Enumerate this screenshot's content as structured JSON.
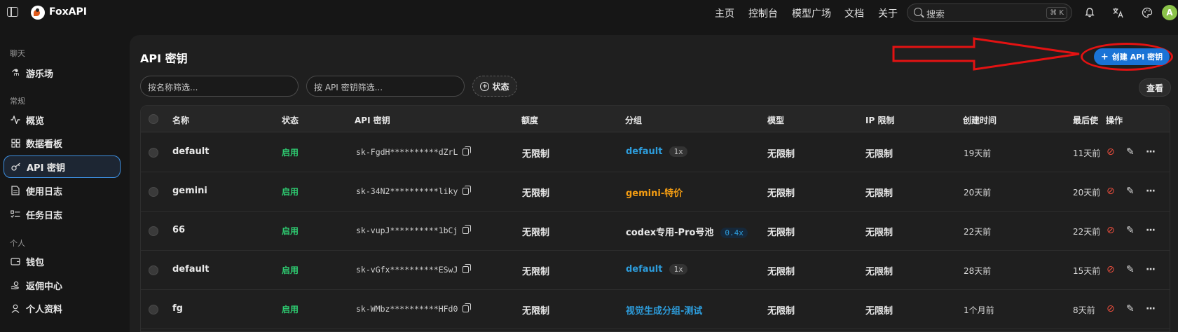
{
  "app": {
    "title": "FoxAPI"
  },
  "topnav": {
    "items": [
      "主页",
      "控制台",
      "模型广场",
      "文档",
      "关于"
    ]
  },
  "search": {
    "placeholder": "搜索",
    "shortcut": "⌘ K"
  },
  "icons": {
    "notifications": "bell-icon",
    "language": "translate-icon",
    "theme": "palette-icon"
  },
  "user": {
    "avatar_letter": "A"
  },
  "sidebar": {
    "sections": [
      {
        "label": "聊天",
        "items": [
          {
            "label": "游乐场",
            "icon": "flask-icon"
          }
        ]
      },
      {
        "label": "常规",
        "items": [
          {
            "label": "概览",
            "icon": "activity-icon"
          },
          {
            "label": "数据看板",
            "icon": "dashboard-icon"
          },
          {
            "label": "API 密钥",
            "icon": "key-icon",
            "active": true
          },
          {
            "label": "使用日志",
            "icon": "log-icon"
          },
          {
            "label": "任务日志",
            "icon": "task-list-icon"
          }
        ]
      },
      {
        "label": "个人",
        "items": [
          {
            "label": "钱包",
            "icon": "wallet-icon"
          },
          {
            "label": "返佣中心",
            "icon": "commission-icon"
          },
          {
            "label": "个人资料",
            "icon": "user-icon"
          }
        ]
      }
    ]
  },
  "page": {
    "title": "API 密钥",
    "create_button": "创建 API 密钥",
    "filter_name_placeholder": "按名称筛选...",
    "filter_key_placeholder": "按 API 密钥筛选...",
    "status_filter": "状态",
    "view_button": "查看"
  },
  "table": {
    "columns": [
      "名称",
      "状态",
      "API 密钥",
      "额度",
      "分组",
      "模型",
      "IP 限制",
      "创建时间",
      "最后使",
      "操作"
    ],
    "rows": [
      {
        "name": "default",
        "status": "启用",
        "key": "sk-FgdH**********dZrL",
        "quota": "无限制",
        "group": "default",
        "group_style": "blue",
        "ratio": "1x",
        "model": "无限制",
        "ip": "无限制",
        "created": "19天前",
        "last_used": "11天前"
      },
      {
        "name": "gemini",
        "status": "启用",
        "key": "sk-34N2**********liky",
        "quota": "无限制",
        "group": "gemini-特价",
        "group_style": "orange",
        "ratio": "",
        "model": "无限制",
        "ip": "无限制",
        "created": "20天前",
        "last_used": "20天前"
      },
      {
        "name": "66",
        "status": "启用",
        "key": "sk-vupJ**********1bCj",
        "quota": "无限制",
        "group": "codex专用-Pro号池",
        "group_style": "plain",
        "ratio": "0.4x",
        "model": "无限制",
        "ip": "无限制",
        "created": "22天前",
        "last_used": "22天前"
      },
      {
        "name": "default",
        "status": "启用",
        "key": "sk-vGfx**********ESwJ",
        "quota": "无限制",
        "group": "default",
        "group_style": "blue",
        "ratio": "1x",
        "model": "无限制",
        "ip": "无限制",
        "created": "28天前",
        "last_used": "15天前"
      },
      {
        "name": "fg",
        "status": "启用",
        "key": "sk-WMbz**********HFd0",
        "quota": "无限制",
        "group": "视觉生成分组-测试",
        "group_style": "blue",
        "ratio": "",
        "model": "无限制",
        "ip": "无限制",
        "created": "1个月前",
        "last_used": "8天前"
      }
    ]
  },
  "colors": {
    "accent": "#1a73d6",
    "status_enabled": "#2ecc71",
    "annotation": "#e31212",
    "group_blue": "#2d9cdb",
    "group_orange": "#f39c12"
  }
}
